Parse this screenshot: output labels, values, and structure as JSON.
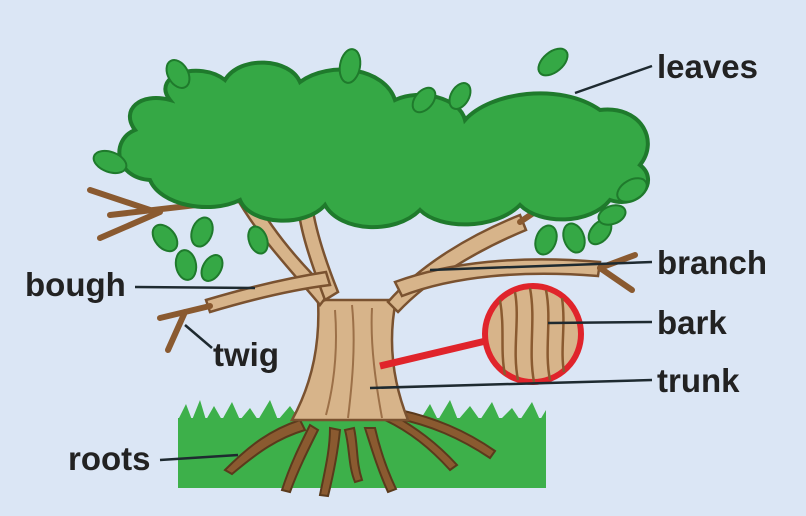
{
  "labels": {
    "leaves": "leaves",
    "branch": "branch",
    "bark": "bark",
    "trunk": "trunk",
    "bough": "bough",
    "twig": "twig",
    "roots": "roots"
  },
  "colors": {
    "background": "#dbe6f5",
    "leaf_green": "#35a845",
    "leaf_outline": "#1f7a2c",
    "grass": "#3db04a",
    "wood": "#d7b48a",
    "wood_outline": "#7a5230",
    "magnifier_ring": "#e0242b",
    "label_text": "#222222"
  }
}
